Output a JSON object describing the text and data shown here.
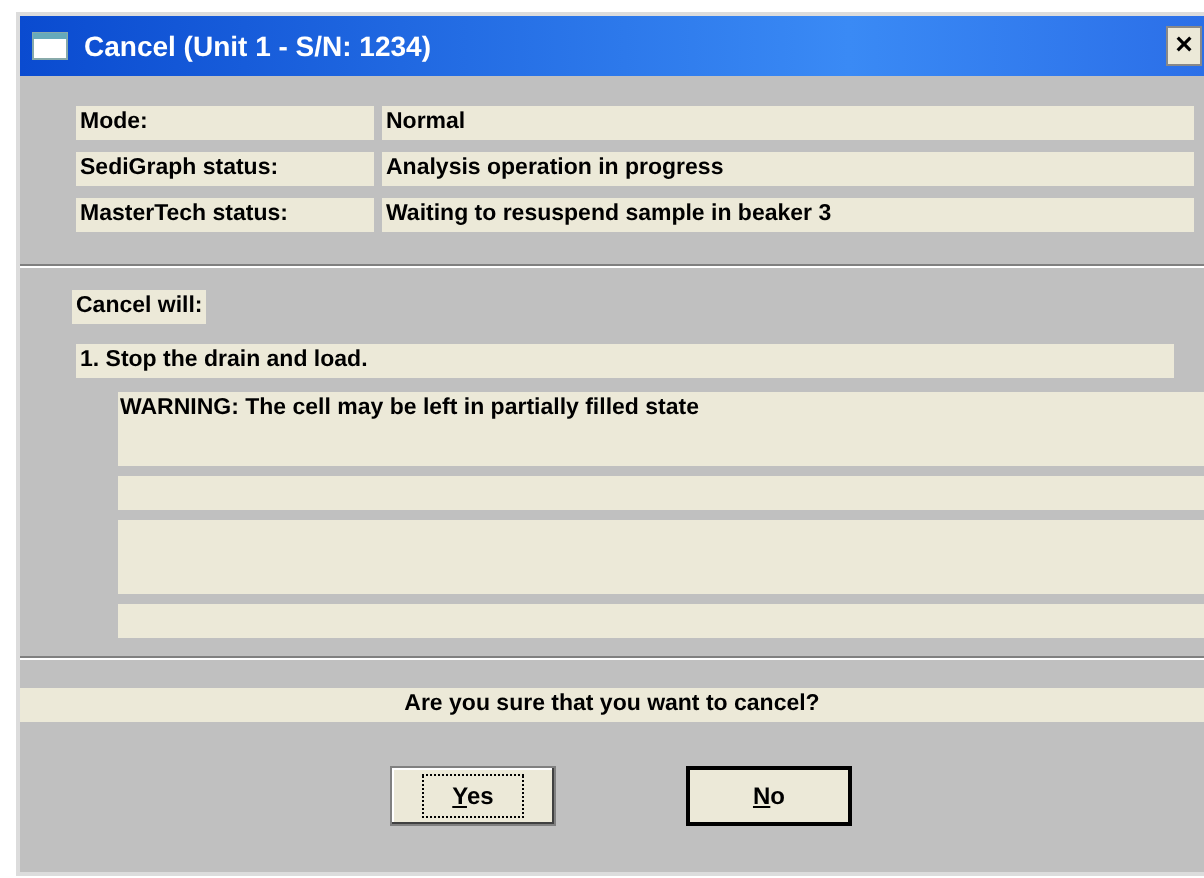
{
  "window": {
    "title": "Cancel (Unit 1 - S/N: 1234)",
    "close": "×"
  },
  "status": [
    {
      "label": "Mode:",
      "value": "Normal"
    },
    {
      "label": "SediGraph status:",
      "value": "Analysis operation in progress"
    },
    {
      "label": "MasterTech status:",
      "value": "Waiting to resuspend sample in beaker  3"
    }
  ],
  "cancel_heading": "Cancel will:",
  "steps": [
    {
      "text": "1.  Stop the drain and load.",
      "notes": [
        "WARNING: The cell may be left in partially filled state"
      ]
    }
  ],
  "question": "Are you sure that you want to cancel?",
  "buttons": [
    {
      "label": "Yes",
      "underline_first": true,
      "focused": true,
      "default": false
    },
    {
      "label": "No",
      "underline_first": true,
      "focused": false,
      "default": true
    }
  ]
}
